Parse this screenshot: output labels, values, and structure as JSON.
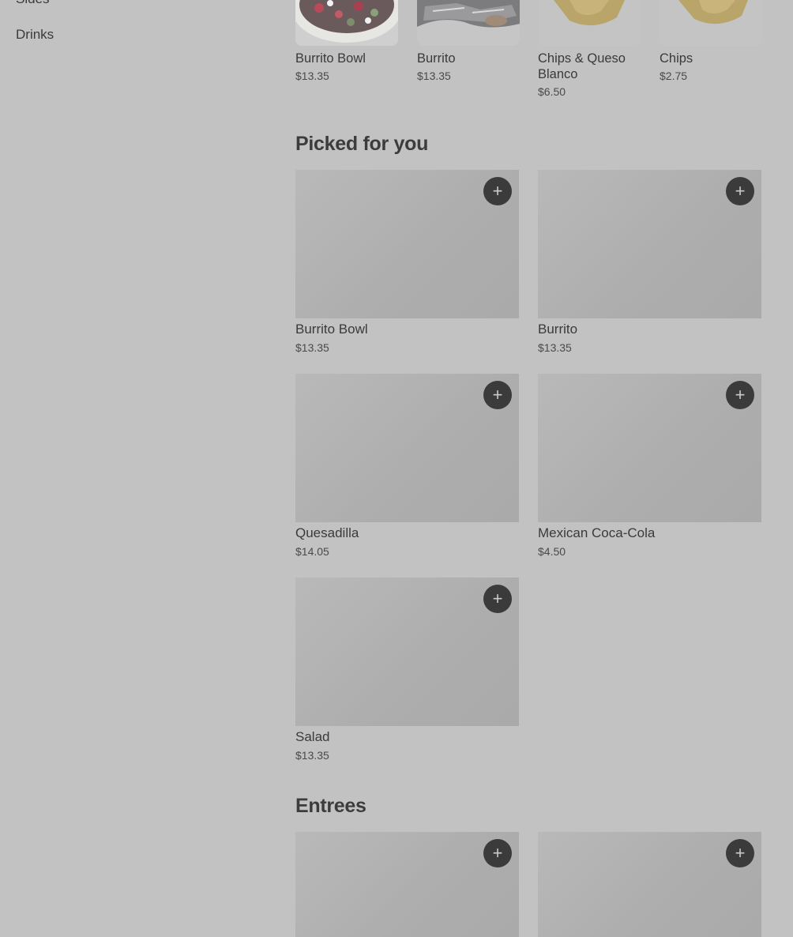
{
  "sidebar": {
    "items": [
      {
        "label": "Sides"
      },
      {
        "label": "Drinks"
      }
    ]
  },
  "featured": [
    {
      "name": "Burrito Bowl",
      "price": "$13.35"
    },
    {
      "name": "Burrito",
      "price": "$13.35"
    },
    {
      "name": "Chips & Queso Blanco",
      "price": "$6.50"
    },
    {
      "name": "Chips",
      "price": "$2.75"
    }
  ],
  "picked_for_you": {
    "title": "Picked for you",
    "items": [
      {
        "name": "Burrito Bowl",
        "price": "$13.35"
      },
      {
        "name": "Burrito",
        "price": "$13.35"
      },
      {
        "name": "Quesadilla",
        "price": "$14.05"
      },
      {
        "name": "Mexican Coca-Cola",
        "price": "$4.50"
      },
      {
        "name": "Salad",
        "price": "$13.35"
      }
    ]
  },
  "entrees": {
    "title": "Entrees"
  },
  "add_symbol": "+"
}
